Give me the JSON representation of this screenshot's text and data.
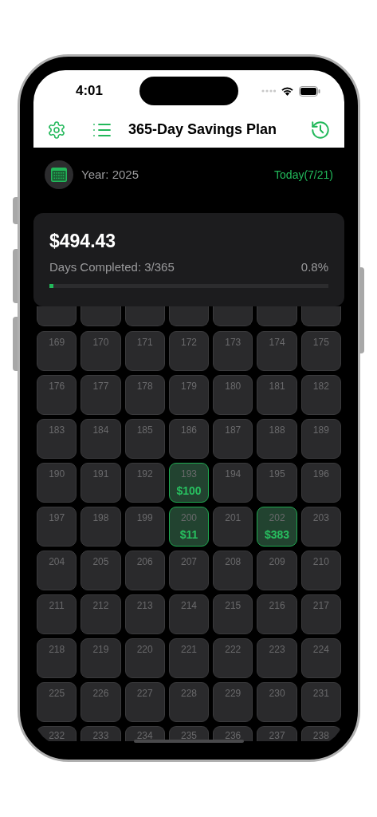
{
  "status_bar": {
    "time": "4:01"
  },
  "nav": {
    "title": "365-Day Savings Plan"
  },
  "year": {
    "label": "Year: 2025",
    "today": "Today(7/21)"
  },
  "summary": {
    "total": "$494.43",
    "days_completed": "Days Completed: 3/365",
    "percent": "0.8%",
    "level": 0.008
  },
  "grid": {
    "rows": [
      [
        {
          "day": "169",
          "completed": false
        },
        {
          "day": "170",
          "completed": false
        },
        {
          "day": "171",
          "completed": false
        },
        {
          "day": "172",
          "completed": false
        },
        {
          "day": "173",
          "completed": false
        },
        {
          "day": "174",
          "completed": false
        },
        {
          "day": "175",
          "completed": false
        }
      ],
      [
        {
          "day": "176",
          "completed": false
        },
        {
          "day": "177",
          "completed": false
        },
        {
          "day": "178",
          "completed": false
        },
        {
          "day": "179",
          "completed": false
        },
        {
          "day": "180",
          "completed": false
        },
        {
          "day": "181",
          "completed": false
        },
        {
          "day": "182",
          "completed": false
        }
      ],
      [
        {
          "day": "183",
          "completed": false
        },
        {
          "day": "184",
          "completed": false
        },
        {
          "day": "185",
          "completed": false
        },
        {
          "day": "186",
          "completed": false
        },
        {
          "day": "187",
          "completed": false
        },
        {
          "day": "188",
          "completed": false
        },
        {
          "day": "189",
          "completed": false
        }
      ],
      [
        {
          "day": "190",
          "completed": false
        },
        {
          "day": "191",
          "completed": false
        },
        {
          "day": "192",
          "completed": false
        },
        {
          "day": "193",
          "completed": true,
          "amount": "$100"
        },
        {
          "day": "194",
          "completed": false
        },
        {
          "day": "195",
          "completed": false
        },
        {
          "day": "196",
          "completed": false
        }
      ],
      [
        {
          "day": "197",
          "completed": false
        },
        {
          "day": "198",
          "completed": false
        },
        {
          "day": "199",
          "completed": false
        },
        {
          "day": "200",
          "completed": true,
          "amount": "$11"
        },
        {
          "day": "201",
          "completed": false
        },
        {
          "day": "202",
          "completed": true,
          "amount": "$383"
        },
        {
          "day": "203",
          "completed": false
        }
      ],
      [
        {
          "day": "204",
          "completed": false
        },
        {
          "day": "205",
          "completed": false
        },
        {
          "day": "206",
          "completed": false
        },
        {
          "day": "207",
          "completed": false
        },
        {
          "day": "208",
          "completed": false
        },
        {
          "day": "209",
          "completed": false
        },
        {
          "day": "210",
          "completed": false
        }
      ],
      [
        {
          "day": "211",
          "completed": false
        },
        {
          "day": "212",
          "completed": false
        },
        {
          "day": "213",
          "completed": false
        },
        {
          "day": "214",
          "completed": false
        },
        {
          "day": "215",
          "completed": false
        },
        {
          "day": "216",
          "completed": false
        },
        {
          "day": "217",
          "completed": false
        }
      ],
      [
        {
          "day": "218",
          "completed": false
        },
        {
          "day": "219",
          "completed": false
        },
        {
          "day": "220",
          "completed": false
        },
        {
          "day": "221",
          "completed": false
        },
        {
          "day": "222",
          "completed": false
        },
        {
          "day": "223",
          "completed": false
        },
        {
          "day": "224",
          "completed": false
        }
      ],
      [
        {
          "day": "225",
          "completed": false
        },
        {
          "day": "226",
          "completed": false
        },
        {
          "day": "227",
          "completed": false
        },
        {
          "day": "228",
          "completed": false
        },
        {
          "day": "229",
          "completed": false
        },
        {
          "day": "230",
          "completed": false
        },
        {
          "day": "231",
          "completed": false
        }
      ],
      [
        {
          "day": "232",
          "completed": false
        },
        {
          "day": "233",
          "completed": false
        },
        {
          "day": "234",
          "completed": false
        },
        {
          "day": "235",
          "completed": false
        },
        {
          "day": "236",
          "completed": false
        },
        {
          "day": "237",
          "completed": false
        },
        {
          "day": "238",
          "completed": false
        }
      ]
    ]
  }
}
